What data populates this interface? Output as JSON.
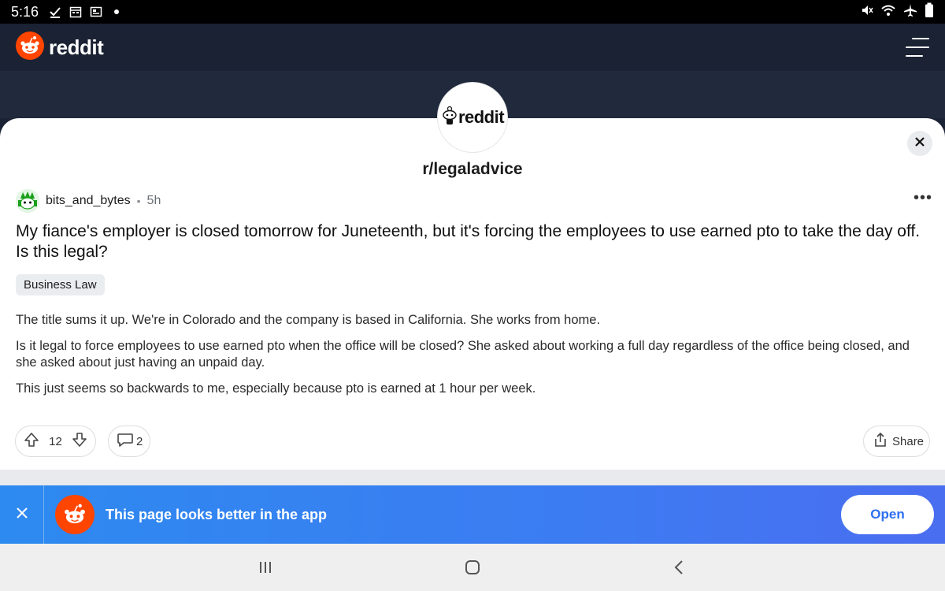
{
  "status_bar": {
    "time": "5:16",
    "left_icons": [
      "checkmark-icon",
      "calendar-icon",
      "screenshot-icon",
      "notification-dot-icon"
    ],
    "right_icons": [
      "mute-icon",
      "wifi-icon",
      "airplane-icon",
      "battery-icon"
    ]
  },
  "header": {
    "logo_text": "reddit",
    "menu_icon": "hamburger-menu-icon"
  },
  "subreddit": {
    "avatar_text": "reddit",
    "name": "r/legaladvice"
  },
  "post": {
    "author": "bits_and_bytes",
    "separator": "•",
    "age": "5h",
    "more_label": "•••",
    "title": "My fiance's employer is closed tomorrow for Juneteenth, but it's forcing the employees to use earned pto to take the day off. Is this legal?",
    "flair": "Business Law",
    "body": [
      "The title sums it up. We're in Colorado and the company is based in California. She works from home.",
      "Is it legal to force employees to use earned pto when the office will be closed? She asked about working a full day regardless of the office being closed, and she asked about just having an unpaid day.",
      "This just seems so backwards to me, especially because pto is earned at 1 hour per week."
    ],
    "votes": "12",
    "comments": "2",
    "share_label": "Share"
  },
  "app_banner": {
    "text": "This page looks better in the app",
    "open_label": "Open"
  },
  "colors": {
    "brand": "#ff4500",
    "header_bg": "#1a2233",
    "banner_start": "#2d8af0",
    "banner_end": "#4a6ef0"
  },
  "system_nav": {
    "icons": [
      "recent-apps-icon",
      "home-icon",
      "back-icon"
    ]
  }
}
